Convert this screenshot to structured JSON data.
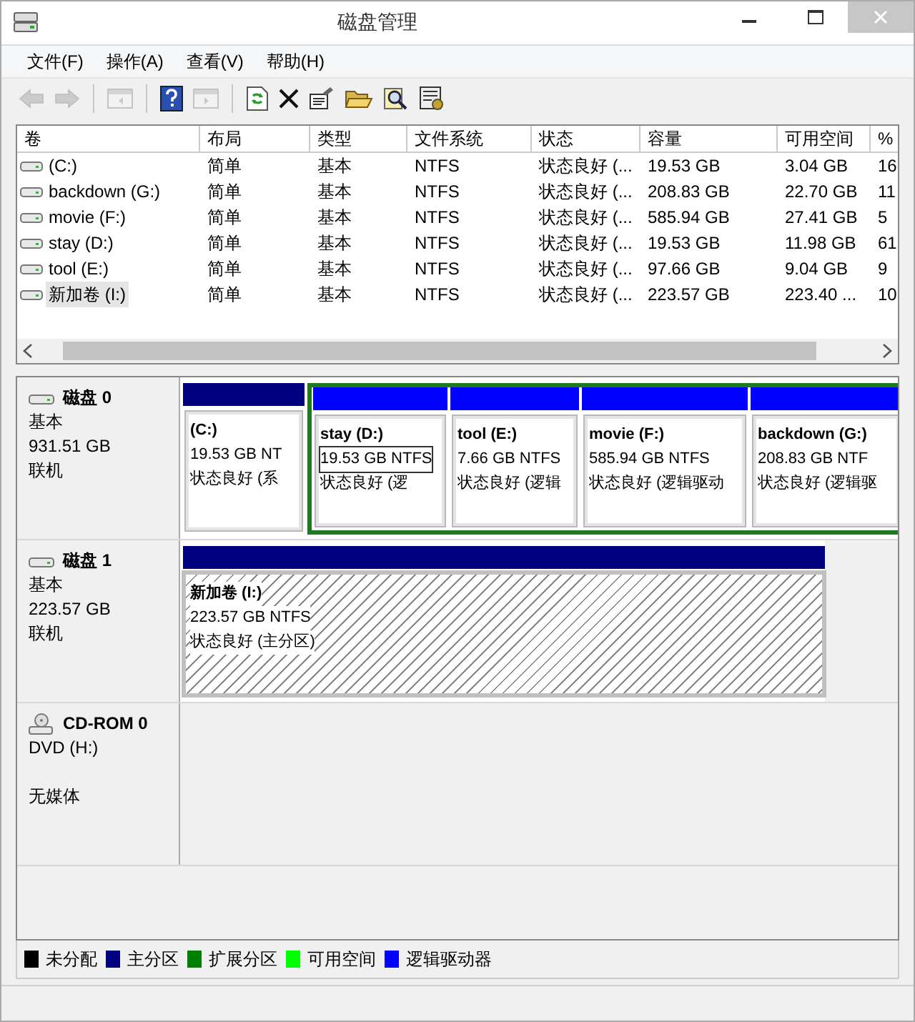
{
  "window": {
    "title": "磁盘管理"
  },
  "menu": [
    "文件(F)",
    "操作(A)",
    "查看(V)",
    "帮助(H)"
  ],
  "toolbar": [
    {
      "disabled": true
    },
    {
      "disabled": true
    },
    {
      "disabled": true
    },
    {
      "disabled": false
    },
    {
      "disabled": true
    },
    {
      "disabled": false
    },
    {
      "disabled": false
    },
    {
      "disabled": false
    },
    {
      "disabled": false
    },
    {
      "disabled": false
    },
    {
      "disabled": false
    }
  ],
  "table": {
    "columns": [
      "卷",
      "布局",
      "类型",
      "文件系统",
      "状态",
      "容量",
      "可用空间",
      "%"
    ],
    "rows": [
      {
        "cells": [
          "(C:)",
          "简单",
          "基本",
          "NTFS",
          "状态良好 (...",
          "19.53 GB",
          "3.04 GB",
          "16"
        ],
        "selected": false
      },
      {
        "cells": [
          "backdown (G:)",
          "简单",
          "基本",
          "NTFS",
          "状态良好 (...",
          "208.83 GB",
          "22.70 GB",
          "11"
        ],
        "selected": false
      },
      {
        "cells": [
          "movie (F:)",
          "简单",
          "基本",
          "NTFS",
          "状态良好 (...",
          "585.94 GB",
          "27.41 GB",
          "5"
        ],
        "selected": false
      },
      {
        "cells": [
          "stay (D:)",
          "简单",
          "基本",
          "NTFS",
          "状态良好 (...",
          "19.53 GB",
          "11.98 GB",
          "61"
        ],
        "selected": false
      },
      {
        "cells": [
          "tool (E:)",
          "简单",
          "基本",
          "NTFS",
          "状态良好 (...",
          "97.66 GB",
          "9.04 GB",
          "9"
        ],
        "selected": false
      },
      {
        "cells": [
          "新加卷 (I:)",
          "简单",
          "基本",
          "NTFS",
          "状态良好 (...",
          "223.57 GB",
          "223.40 ...",
          "10"
        ],
        "selected": true
      }
    ]
  },
  "disks": [
    {
      "kind": "disk",
      "name": "磁盘 0",
      "type": "基本",
      "size": "931.51 GB",
      "status": "联机",
      "partitions": [
        {
          "kind": "primary",
          "name": "(C:)",
          "size": "19.53 GB NT",
          "status": "状态良好 (系",
          "selected": false,
          "focused": false
        },
        {
          "kind": "extended",
          "children": [
            {
              "kind": "logical",
              "name": "stay  (D:)",
              "size": "19.53 GB NTFS",
              "status": "状态良好 (逻",
              "selected": false,
              "focused": true
            },
            {
              "kind": "logical",
              "name": "tool  (E:)",
              "size": "7.66 GB NTFS",
              "status": "状态良好 (逻辑",
              "selected": false,
              "focused": false
            },
            {
              "kind": "logical",
              "name": "movie  (F:)",
              "size": "585.94 GB NTFS",
              "status": "状态良好 (逻辑驱动",
              "selected": false,
              "focused": false
            },
            {
              "kind": "logical",
              "name": "backdown  (G:)",
              "size": "208.83 GB NTF",
              "status": "状态良好 (逻辑驱",
              "selected": false,
              "focused": false
            }
          ]
        }
      ]
    },
    {
      "kind": "disk",
      "name": "磁盘 1",
      "type": "基本",
      "size": "223.57 GB",
      "status": "联机",
      "partitions": [
        {
          "kind": "primary",
          "name": "新加卷  (I:)",
          "size": "223.57 GB NTFS",
          "status": "状态良好 (主分区)",
          "selected": true,
          "focused": false
        }
      ]
    },
    {
      "kind": "cdrom",
      "name": "CD-ROM 0",
      "type": "DVD (H:)",
      "status": "无媒体"
    }
  ],
  "legend": [
    {
      "label": "未分配",
      "color": "#000000"
    },
    {
      "label": "主分区",
      "color": "#000080"
    },
    {
      "label": "扩展分区",
      "color": "#008000"
    },
    {
      "label": "可用空间",
      "color": "#00ff00"
    },
    {
      "label": "逻辑驱动器",
      "color": "#0000ff"
    }
  ]
}
